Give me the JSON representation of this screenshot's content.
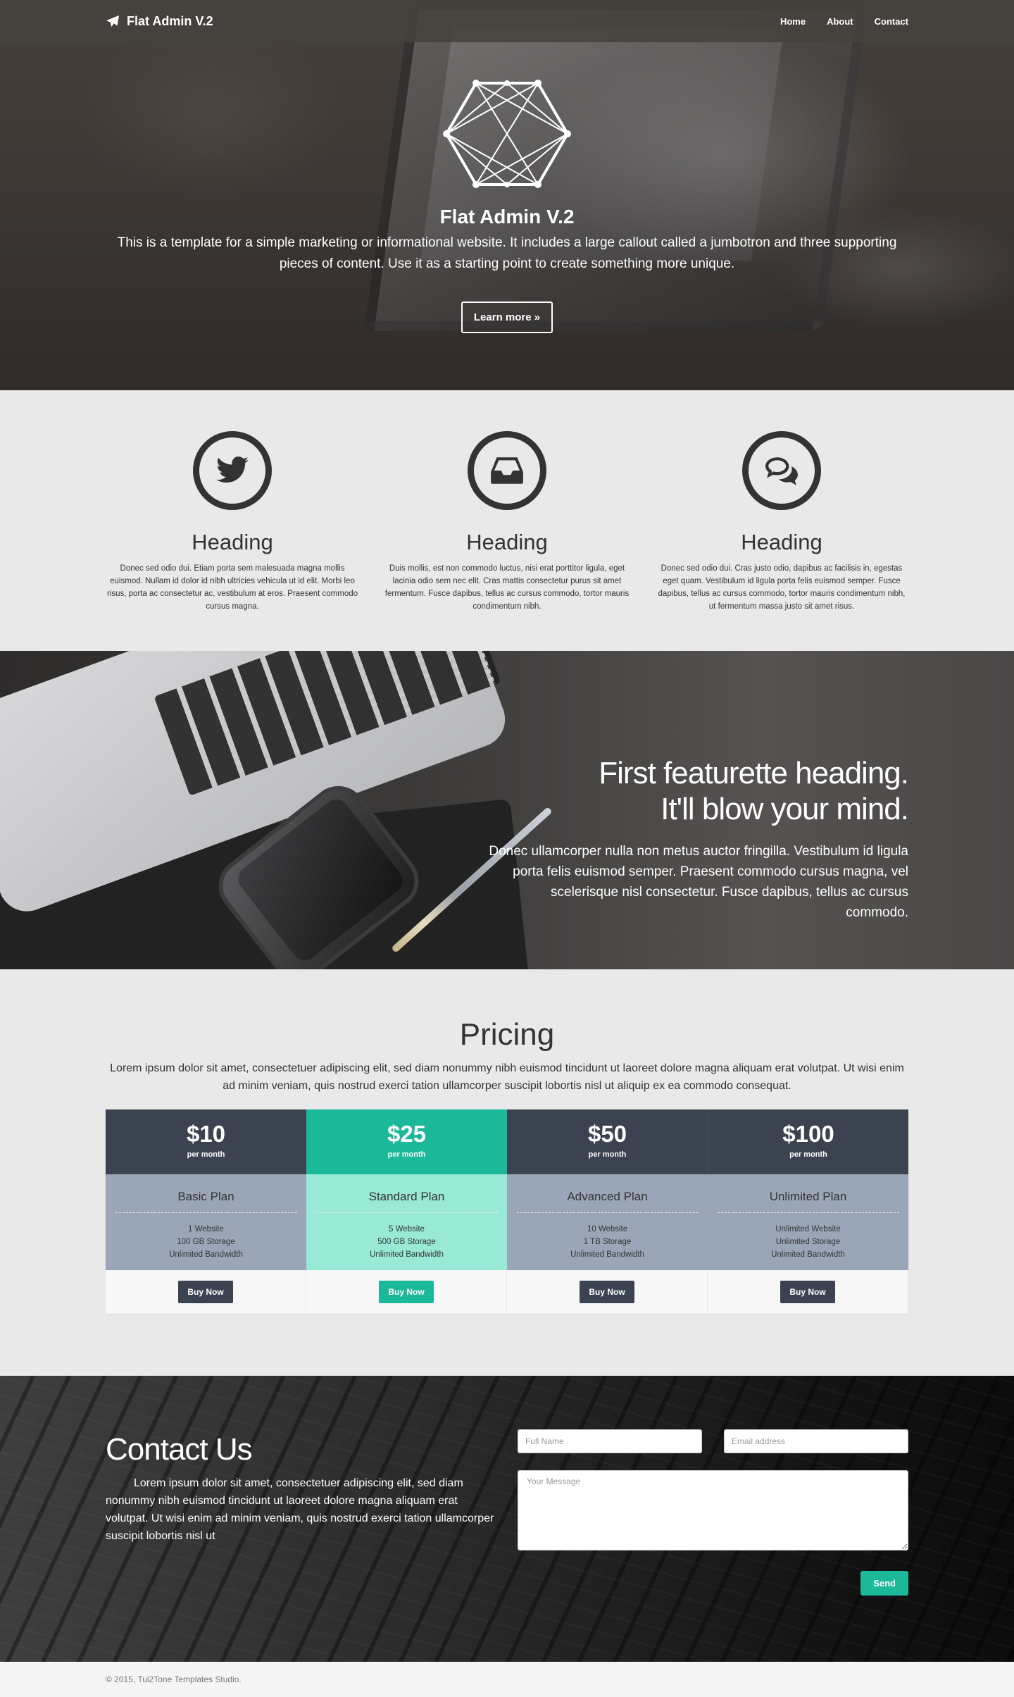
{
  "nav": {
    "brand": "Flat Admin V.2",
    "links": [
      "Home",
      "About",
      "Contact"
    ]
  },
  "hero": {
    "title": "Flat Admin V.2",
    "description": "This is a template for a simple marketing or informational website. It includes a large callout called a jumbotron and three supporting pieces of content. Use it as a starting point to create something more unique.",
    "button": "Learn more »"
  },
  "features": [
    {
      "icon": "twitter-icon",
      "heading": "Heading",
      "text": "Donec sed odio dui. Etiam porta sem malesuada magna mollis euismod. Nullam id dolor id nibh ultricies vehicula ut id elit. Morbi leo risus, porta ac consectetur ac, vestibulum at eros. Praesent commodo cursus magna."
    },
    {
      "icon": "inbox-icon",
      "heading": "Heading",
      "text": "Duis mollis, est non commodo luctus, nisi erat porttitor ligula, eget lacinia odio sem nec elit. Cras mattis consectetur purus sit amet fermentum. Fusce dapibus, tellus ac cursus commodo, tortor mauris condimentum nibh."
    },
    {
      "icon": "comments-icon",
      "heading": "Heading",
      "text": "Donec sed odio dui. Cras justo odio, dapibus ac facilisis in, egestas eget quam. Vestibulum id ligula porta felis euismod semper. Fusce dapibus, tellus ac cursus commodo, tortor mauris condimentum nibh, ut fermentum massa justo sit amet risus."
    }
  ],
  "featurette": {
    "heading_line1": "First featurette heading.",
    "heading_line2": "It'll blow your mind.",
    "text": "Donec ullamcorper nulla non metus auctor fringilla. Vestibulum id ligula porta felis euismod semper. Praesent commodo cursus magna, vel scelerisque nisl consectetur. Fusce dapibus, tellus ac cursus commodo."
  },
  "pricing": {
    "title": "Pricing",
    "description": "Lorem ipsum dolor sit amet, consectetuer adipiscing elit, sed diam nonummy nibh euismod tincidunt ut laoreet dolore magna aliquam erat volutpat. Ut wisi enim ad minim veniam, quis nostrud exerci tation ullamcorper suscipit lobortis nisl ut aliquip ex ea commodo consequat.",
    "plans": [
      {
        "price": "$10",
        "period": "per month",
        "name": "Basic Plan",
        "features": [
          "1 Website",
          "100 GB Storage",
          "Unlimited Bandwidth"
        ],
        "button": "Buy Now"
      },
      {
        "price": "$25",
        "period": "per month",
        "name": "Standard Plan",
        "features": [
          "5 Website",
          "500 GB Storage",
          "Unlimited Bandwidth"
        ],
        "button": "Buy Now"
      },
      {
        "price": "$50",
        "period": "per month",
        "name": "Advanced Plan",
        "features": [
          "10 Website",
          "1 TB Storage",
          "Unlimited Bandwidth"
        ],
        "button": "Buy Now"
      },
      {
        "price": "$100",
        "period": "per month",
        "name": "Unlimited Plan",
        "features": [
          "Unlimited Website",
          "Unlimited Storage",
          "Unlimited Bandwidth"
        ],
        "button": "Buy Now"
      }
    ]
  },
  "contact": {
    "title": "Contact Us",
    "text": "Lorem ipsum dolor sit amet, consectetuer adipiscing elit, sed diam nonummy nibh euismod tincidunt ut laoreet dolore magna aliquam erat volutpat. Ut wisi enim ad minim veniam, quis nostrud exerci tation ullamcorper suscipit lobortis nisl ut",
    "name_placeholder": "Full Name",
    "email_placeholder": "Email address",
    "message_placeholder": "Your Message",
    "send": "Send"
  },
  "footer": {
    "copyright": "© 2015, Tui2Tone Templates Studio."
  },
  "colors": {
    "accent": "#1bb899",
    "dark_slate": "#3c4350",
    "plan_body": "#9aa6b8",
    "featured_body": "#98e9d6"
  }
}
